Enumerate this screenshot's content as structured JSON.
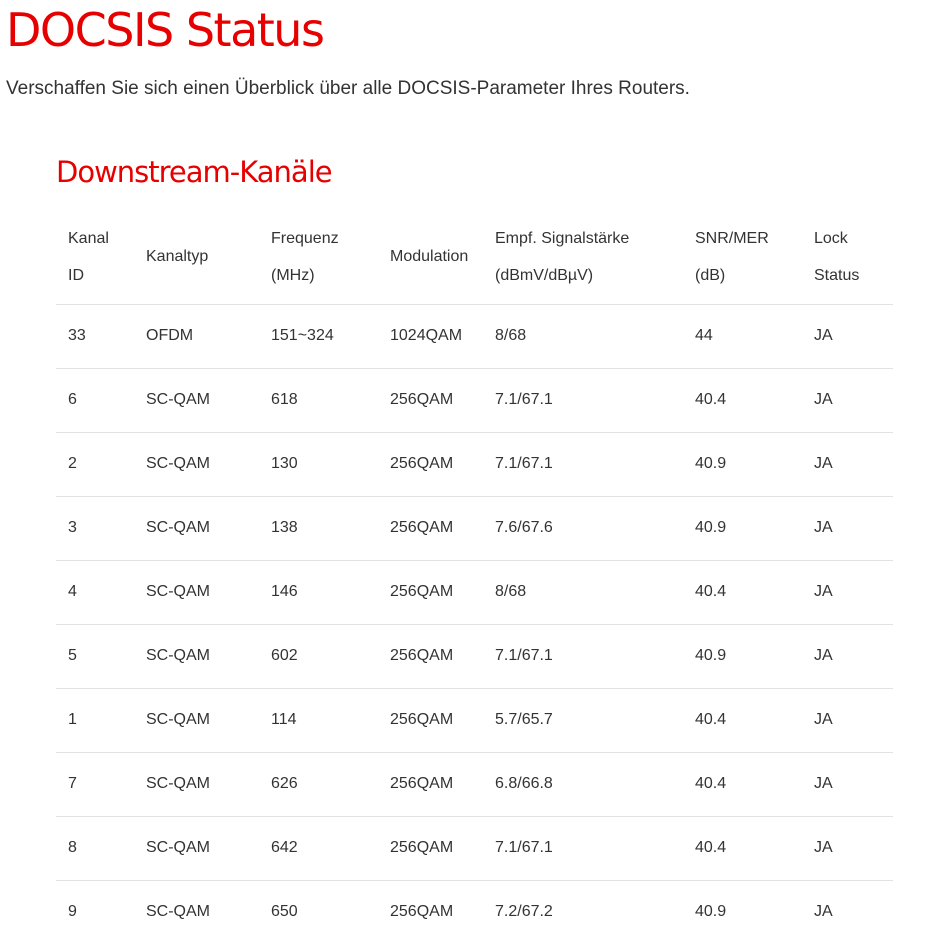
{
  "page": {
    "title": "DOCSIS Status",
    "subtitle": "Verschaffen Sie sich einen Überblick über alle DOCSIS-Parameter Ihres Routers."
  },
  "downstream": {
    "title": "Downstream-Kanäle",
    "headers": {
      "id_line1": "Kanal",
      "id_line2": "ID",
      "type": "Kanaltyp",
      "freq_line1": "Frequenz",
      "freq_line2": "(MHz)",
      "modulation": "Modulation",
      "power_line1": "Empf. Signalstärke",
      "power_line2": "(dBmV/dBµV)",
      "snr_line1": "SNR/MER",
      "snr_line2": "(dB)",
      "lock_line1": "Lock",
      "lock_line2": "Status"
    },
    "rows": [
      {
        "id": "33",
        "type": "OFDM",
        "freq": "151~324",
        "modulation": "1024QAM",
        "power": "8/68",
        "snr": "44",
        "lock": "JA"
      },
      {
        "id": "6",
        "type": "SC-QAM",
        "freq": "618",
        "modulation": "256QAM",
        "power": "7.1/67.1",
        "snr": "40.4",
        "lock": "JA"
      },
      {
        "id": "2",
        "type": "SC-QAM",
        "freq": "130",
        "modulation": "256QAM",
        "power": "7.1/67.1",
        "snr": "40.9",
        "lock": "JA"
      },
      {
        "id": "3",
        "type": "SC-QAM",
        "freq": "138",
        "modulation": "256QAM",
        "power": "7.6/67.6",
        "snr": "40.9",
        "lock": "JA"
      },
      {
        "id": "4",
        "type": "SC-QAM",
        "freq": "146",
        "modulation": "256QAM",
        "power": "8/68",
        "snr": "40.4",
        "lock": "JA"
      },
      {
        "id": "5",
        "type": "SC-QAM",
        "freq": "602",
        "modulation": "256QAM",
        "power": "7.1/67.1",
        "snr": "40.9",
        "lock": "JA"
      },
      {
        "id": "1",
        "type": "SC-QAM",
        "freq": "114",
        "modulation": "256QAM",
        "power": "5.7/65.7",
        "snr": "40.4",
        "lock": "JA"
      },
      {
        "id": "7",
        "type": "SC-QAM",
        "freq": "626",
        "modulation": "256QAM",
        "power": "6.8/66.8",
        "snr": "40.4",
        "lock": "JA"
      },
      {
        "id": "8",
        "type": "SC-QAM",
        "freq": "642",
        "modulation": "256QAM",
        "power": "7.1/67.1",
        "snr": "40.4",
        "lock": "JA"
      },
      {
        "id": "9",
        "type": "SC-QAM",
        "freq": "650",
        "modulation": "256QAM",
        "power": "7.2/67.2",
        "snr": "40.9",
        "lock": "JA"
      }
    ]
  },
  "colors": {
    "accent": "#e60000",
    "text": "#333333",
    "divider": "#e2e2e2"
  }
}
